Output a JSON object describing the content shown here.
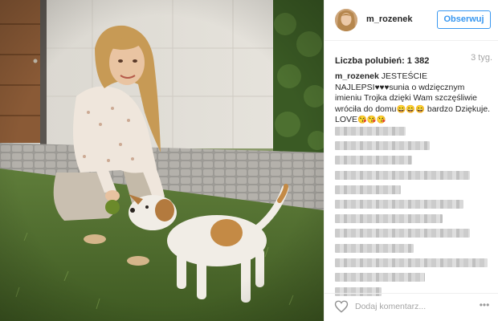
{
  "post": {
    "photo": {
      "alt_subject": "woman-with-dog-photo"
    },
    "header": {
      "username": "m_rozenek",
      "follow_label": "Obserwuj"
    },
    "likes": {
      "label": "Liczba polubień:",
      "count": "1 382"
    },
    "time_ago": "3 tyg.",
    "caption": {
      "user": "m_rozenek",
      "part1": " JESTEŚCIE NAJLEPSI",
      "hearts": "♥♥♥",
      "part2": "sunia o wdzięcznym imieniu Trojka dzięki Wam szczęśliwie wróciła do domu",
      "emoji1": "😄😄😄",
      "part3": " bardzo Dziękuje. LOVE",
      "emoji2": "😘😘😘"
    },
    "comments": {
      "blurred_lines": [
        1,
        1,
        1,
        1,
        1,
        1,
        1,
        1,
        1,
        1,
        1,
        1
      ]
    },
    "footer": {
      "comment_placeholder": "Dodaj komentarz...",
      "more_label": "•••"
    },
    "colors": {
      "accent": "#3897f0",
      "text": "#262626",
      "muted": "#a5a5a5",
      "border": "#efefef"
    }
  }
}
